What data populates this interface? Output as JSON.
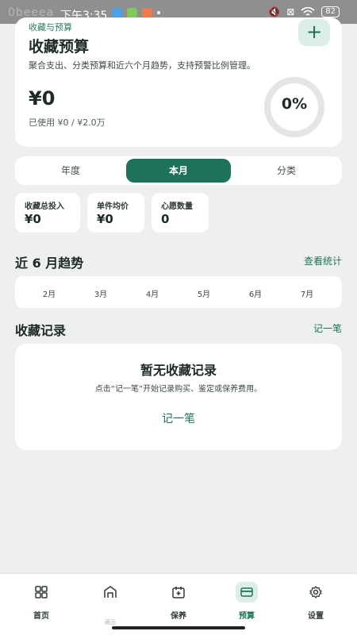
{
  "status_bar": {
    "ghost_text": "0beeea",
    "time": "下午3:35",
    "battery": "82"
  },
  "hero": {
    "kicker": "收藏与预算",
    "title": "收藏预算",
    "description": "聚合支出、分类预算和近六个月趋势，支持预警比例管理。",
    "amount": "¥0",
    "used_text": "已使用 ¥0 / ¥2.0万",
    "percent_label": "0%",
    "percent_value": 0,
    "add_label": "+"
  },
  "tabs": [
    {
      "label": "年度",
      "active": false
    },
    {
      "label": "本月",
      "active": true
    },
    {
      "label": "分类",
      "active": false
    }
  ],
  "stats": [
    {
      "label": "收藏总投入",
      "value": "¥0"
    },
    {
      "label": "单件均价",
      "value": "¥0"
    },
    {
      "label": "心愿数量",
      "value": "0"
    }
  ],
  "trend": {
    "title": "近 6 月趋势",
    "link": "查看统计",
    "months": [
      "2月",
      "3月",
      "4月",
      "5月",
      "6月",
      "7月"
    ]
  },
  "records": {
    "title": "收藏记录",
    "link": "记一笔",
    "empty_title": "暂无收藏记录",
    "empty_desc": "点击“记一笔”开始记录购买、鉴定或保养费用。",
    "empty_button": "记一笔"
  },
  "nav": [
    {
      "label": "首页",
      "icon": "grid-icon",
      "active": false
    },
    {
      "label": "",
      "ghost": "藏品",
      "icon": "building-icon",
      "active": false
    },
    {
      "label": "保养",
      "icon": "calendar-icon",
      "active": false
    },
    {
      "label": "预算",
      "icon": "card-icon",
      "active": true
    },
    {
      "label": "设置",
      "icon": "gear-icon",
      "active": false
    }
  ],
  "colors": {
    "accent": "#1e7259",
    "accent_soft": "#dcefe6",
    "background": "#eef0ee"
  }
}
